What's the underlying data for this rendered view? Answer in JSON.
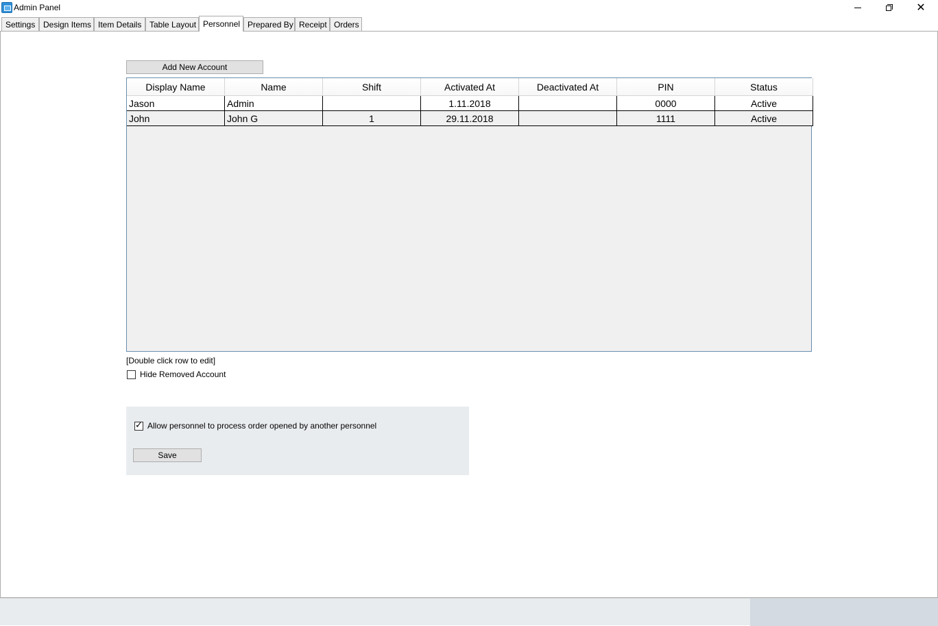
{
  "window": {
    "title": "Admin Panel",
    "icon": "app-icon",
    "controls": [
      "minimize-icon",
      "restore-icon",
      "close-icon"
    ]
  },
  "tabs": [
    {
      "label": "Settings"
    },
    {
      "label": "Design Items"
    },
    {
      "label": "Item Details"
    },
    {
      "label": "Table Layout"
    },
    {
      "label": "Personnel",
      "active": true
    },
    {
      "label": "Prepared By"
    },
    {
      "label": "Receipt"
    },
    {
      "label": "Orders"
    }
  ],
  "personnel": {
    "add_button": "Add New Account",
    "columns": [
      "Display Name",
      "Name",
      "Shift",
      "Activated At",
      "Deactivated At",
      "PIN",
      "Status"
    ],
    "rows": [
      {
        "display_name": "Jason",
        "name": "Admin",
        "shift": "",
        "activated_at": "1.11.2018",
        "deactivated_at": "",
        "pin": "0000",
        "status": "Active"
      },
      {
        "display_name": "John",
        "name": "John G",
        "shift": "1",
        "activated_at": "29.11.2018",
        "deactivated_at": "",
        "pin": "1111",
        "status": "Active"
      }
    ],
    "hint": "[Double click row to edit]",
    "hide_removed_label": "Hide Removed Account",
    "hide_removed_checked": false,
    "allow_process_label": "Allow personnel to process order opened by another personnel",
    "allow_process_checked": true,
    "save_button": "Save"
  },
  "colors": {
    "grid_border": "#688caf",
    "panel_bg": "#e9ecef",
    "button_bg": "#e1e1e1"
  }
}
